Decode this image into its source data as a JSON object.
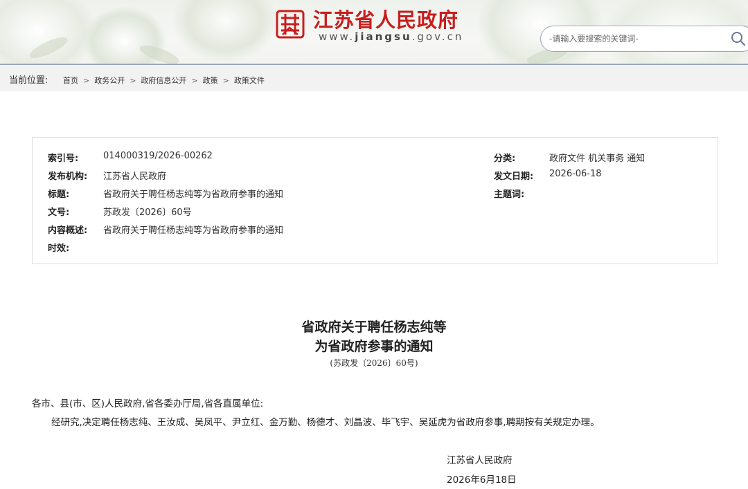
{
  "header": {
    "site_name": "江苏省人民政府",
    "site_url_prefix": "www.",
    "site_url_domain": "jiangsu",
    "site_url_suffix": ".gov.cn",
    "search_placeholder": "-请输入要搜索的关键词-",
    "brand_color": "#c81e1e"
  },
  "breadcrumb": {
    "label": "当前位置:",
    "items": [
      "首页",
      "政务公开",
      "政府信息公开",
      "政策",
      "政策文件"
    ],
    "separator": ">"
  },
  "meta": {
    "left": [
      {
        "key": "索引号:",
        "value": "014000319/2026-00262"
      },
      {
        "key": "发布机构:",
        "value": "江苏省人民政府"
      },
      {
        "key": "标题:",
        "value": "省政府关于聘任杨志纯等为省政府参事的通知"
      },
      {
        "key": "文号:",
        "value": "苏政发〔2026〕60号"
      },
      {
        "key": "内容概述:",
        "value": "省政府关于聘任杨志纯等为省政府参事的通知"
      },
      {
        "key": "时效:",
        "value": ""
      }
    ],
    "right": [
      {
        "key": "分类:",
        "value": "政府文件 机关事务 通知"
      },
      {
        "key": "发文日期:",
        "value": "2026-06-18"
      },
      {
        "key": "主题词:",
        "value": ""
      }
    ]
  },
  "article": {
    "title_line1": "省政府关于聘任杨志纯等",
    "title_line2": "为省政府参事的通知",
    "doc_number": "(苏政发〔2026〕60号)",
    "salutation": "各市、县(市、区)人民政府,省各委办厅局,省各直属单位:",
    "body": "经研究,决定聘任杨志纯、王汝成、吴凤平、尹立红、金万勤、杨德才、刘晶波、毕飞宇、吴延虎为省政府参事,聘期按有关规定办理。",
    "signature": "江苏省人民政府",
    "date": "2026年6月18日"
  }
}
